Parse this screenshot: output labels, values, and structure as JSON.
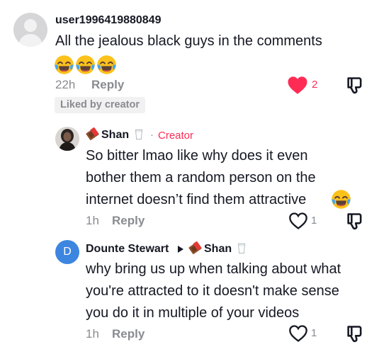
{
  "comment1": {
    "username": "user1996419880849",
    "text": "All the jealous black guys in the comments",
    "emojis": [
      "tears-of-joy-icon",
      "tears-of-joy-icon",
      "tears-of-joy-icon"
    ],
    "time": "22h",
    "reply_label": "Reply",
    "likes": "2",
    "liked": true,
    "badge": "Liked by creator"
  },
  "reply1": {
    "username": "Shan",
    "creator_tag": "Creator",
    "dot": "·",
    "lines": [
      "So bitter lmao like why does it even",
      "bother them a random person on the",
      "internet doesn’t find them attractive"
    ],
    "time": "1h",
    "reply_label": "Reply",
    "likes": "1"
  },
  "reply2": {
    "avatar_letter": "D",
    "username": "Dounte Stewart",
    "reply_to": "Shan",
    "lines": [
      "why bring us up when talking about what",
      "you're attracted to it doesn't make sense",
      "you do it in multiple of your videos"
    ],
    "time": "1h",
    "reply_label": "Reply",
    "likes": "1"
  },
  "colors": {
    "accent": "#fe2c55",
    "text": "#161823",
    "muted": "#8a8b91",
    "avatar_d": "#3d86e0"
  }
}
